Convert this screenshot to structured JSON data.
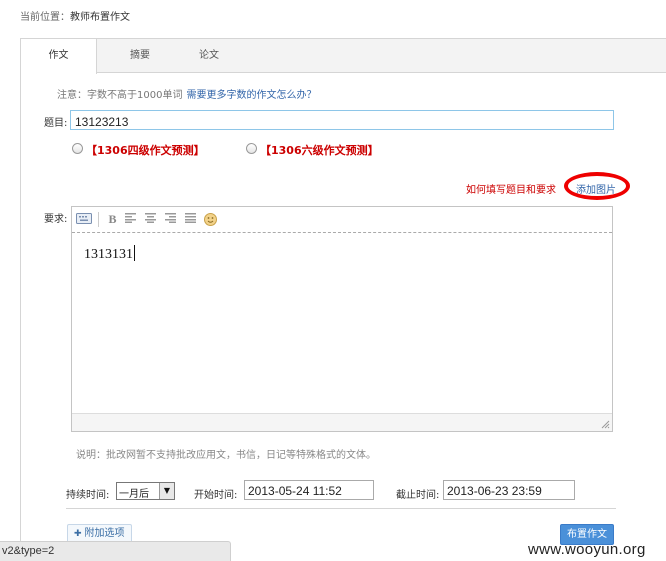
{
  "breadcrumb": {
    "prefix": "当前位置：",
    "current": "教师布置作文"
  },
  "tabs": [
    {
      "label": "作文",
      "active": true
    },
    {
      "label": "摘要",
      "active": false
    },
    {
      "label": "论文",
      "active": false
    }
  ],
  "notice": {
    "text": "注意：字数不高于1000单词",
    "link": "需要更多字数的作文怎么办？"
  },
  "title_field": {
    "label": "题目:",
    "value": "13123213"
  },
  "presets": [
    {
      "label": "【1306四级作文预测】",
      "checked": false
    },
    {
      "label": "【1306六级作文预测】",
      "checked": false
    }
  ],
  "help": {
    "howto": "如何填写题目和要求",
    "add_image": "添加图片",
    "highlight_color": "#ee0000"
  },
  "requirement": {
    "label": "要求:",
    "content": "1313131"
  },
  "note": "说明：批改网暂不支持批改应用文，书信，日记等特殊格式的文体。",
  "settings": {
    "duration_label": "持续时间:",
    "duration_value": "一月后",
    "start_label": "开始时间:",
    "start_value": "2013-05-24 11:52",
    "end_label": "截止时间:",
    "end_value": "2013-06-23 23:59"
  },
  "buttons": {
    "more_options": "附加选项",
    "publish": "布置作文"
  },
  "statusbar": "v2&type=2",
  "watermark": "www.wooyun.org",
  "colors": {
    "link": "#3366aa",
    "accent": "#4a90d9",
    "preset_red": "#cc0000"
  }
}
